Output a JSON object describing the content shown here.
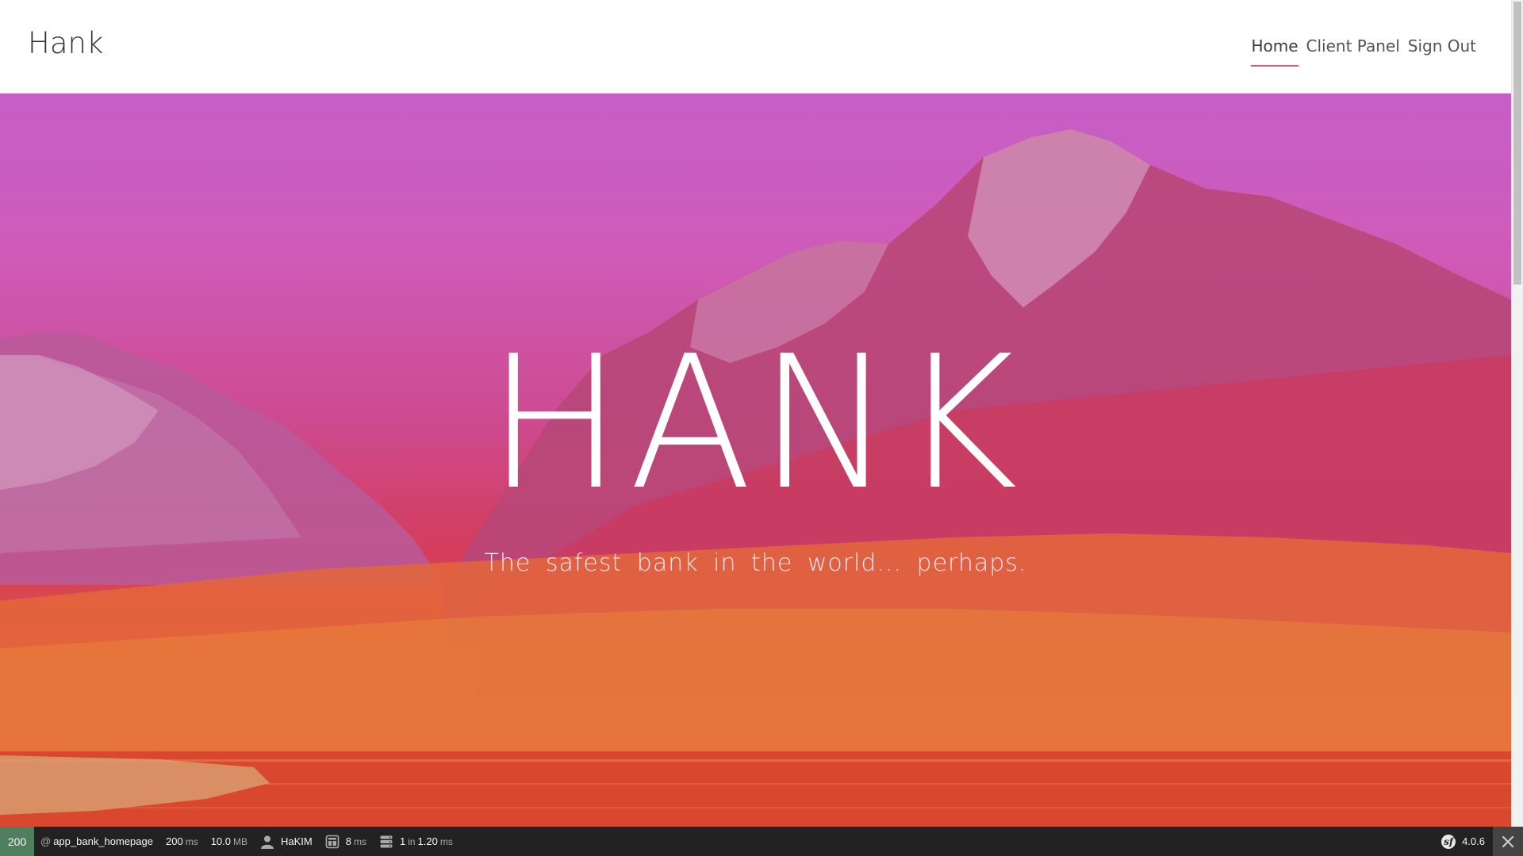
{
  "header": {
    "brand": "Hank",
    "nav": [
      {
        "label": "Home",
        "active": true
      },
      {
        "label": "Client Panel",
        "active": false
      },
      {
        "label": "Sign Out",
        "active": false
      }
    ],
    "active_underline_color": "#e2537a"
  },
  "hero": {
    "title": "HANK",
    "subtitle": "The safest bank in the world... perhaps."
  },
  "toolbar": {
    "status_code": "200",
    "route": "app_bank_homepage",
    "time_value": "200",
    "time_unit": "ms",
    "memory_value": "10.0",
    "memory_unit": "MB",
    "user": "HaKIM",
    "render_value": "8",
    "render_unit": "ms",
    "db_queries": "1",
    "db_in": "in",
    "db_time": "1.20",
    "db_unit": "ms",
    "symfony_version": "4.0.6",
    "status_color": "#4f805d"
  }
}
